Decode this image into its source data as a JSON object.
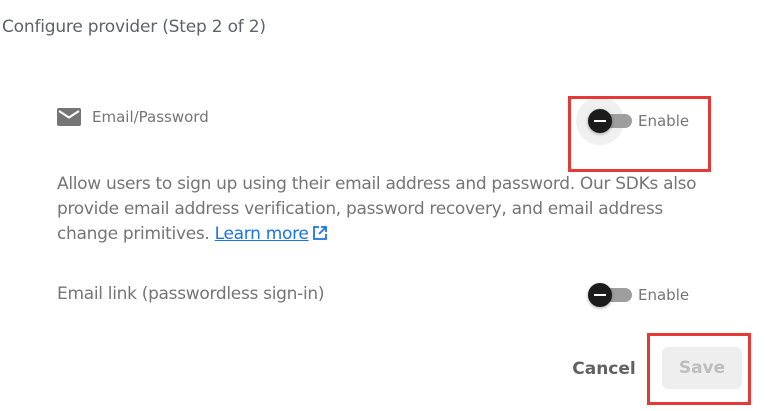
{
  "header": {
    "step_title": "Configure provider (Step 2 of 2)"
  },
  "provider": {
    "icon": "email-icon",
    "label": "Email/Password",
    "toggle_label": "Enable",
    "enabled": false
  },
  "description": {
    "text": "Allow users to sign up using their email address and password. Our SDKs also provide email address verification, password recovery, and email address change primitives.",
    "link_label": "Learn more",
    "link_icon": "external-link-icon"
  },
  "email_link": {
    "label": "Email link (passwordless sign-in)",
    "toggle_label": "Enable",
    "enabled": false
  },
  "actions": {
    "cancel_label": "Cancel",
    "save_label": "Save",
    "save_disabled": true
  },
  "colors": {
    "highlight": "#e53935",
    "link": "#1a73e8",
    "text_muted": "#757575"
  }
}
